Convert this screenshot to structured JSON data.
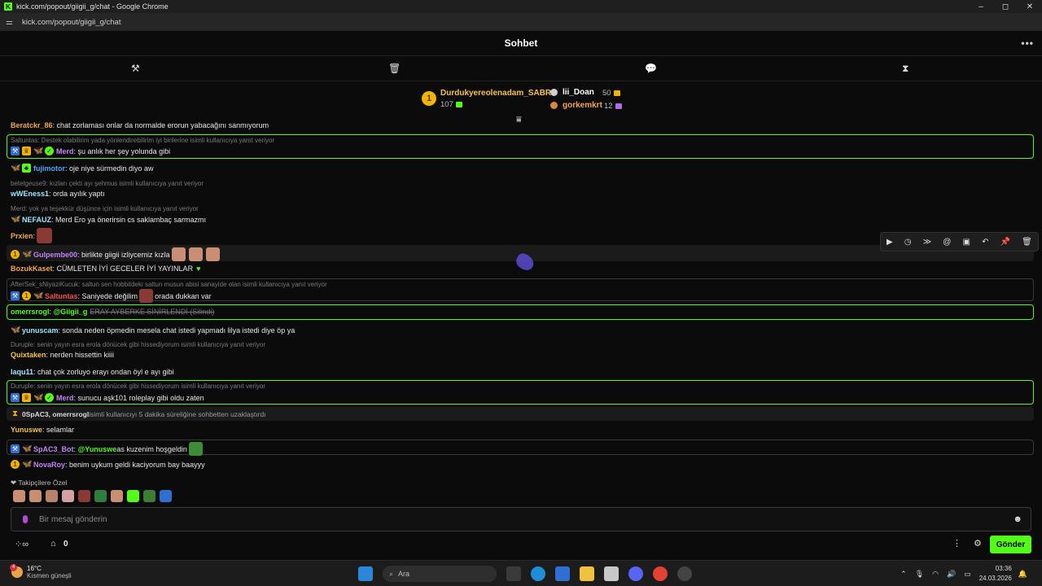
{
  "window": {
    "title": "kick.com/popout/giigii_g/chat - Google Chrome",
    "url": "kick.com/popout/giigii_g/chat",
    "controls": [
      "–",
      "◻",
      "✕"
    ]
  },
  "header": {
    "title": "Sohbet",
    "more": "•••"
  },
  "modbar": {
    "icons": [
      "hammer-icon",
      "trash-icon",
      "chat-bubble-icon",
      "hourglass-icon"
    ]
  },
  "leaderboard": {
    "first": {
      "rank": "1",
      "name": "Durdukyereolenadam_SABRI",
      "count": "107"
    },
    "second": {
      "name": "lii_Doan",
      "count": "50"
    },
    "third": {
      "name": "gorkemkrt",
      "count": "12"
    }
  },
  "messages": [
    {
      "user": "Beratckr_86",
      "text": ": chat zorlaması onlar da normalde erorun yabacağını sanmıyorum"
    },
    {
      "reply": "Saltuntas: Destek olabilirim yada yönlendirebilirim iyi birilerine isimli kullanıcıya yanıt veriyor",
      "user": "Merd",
      "text": ": şu anlık her şey yolunda gibi"
    },
    {
      "user": "fujimotor",
      "text": ": oje niye sürmedin diyo aw"
    },
    {
      "reply": "betelgeuse9: kızları çekti ayı şehmus isimli kullanıcıya yanıt veriyor",
      "user": "wWEness1",
      "text": ": orda ayılık yaptı"
    },
    {
      "reply": "Merd: yok ya teşekkür düşünce için isimli kullanıcıya yanıt veriyor",
      "user": "NEFAUZ",
      "text": ": Merd Ero ya önerirsin cs saklambaç sarmazmı"
    },
    {
      "user": "Prxien",
      "text": ":"
    },
    {
      "user": "Gulpembe00",
      "text": ": birlikte giigii izliycemiz kızla"
    },
    {
      "user": "BozukKaset",
      "text": ": CÜMLETEN İYİ GECELER İYİ YAYINLAR"
    },
    {
      "reply": "AfterSek_sNiyaziKucuk: saltun sen hobbitdeki saltun musun abisi sanayide olan isimli kullanıcıya yanıt veriyor",
      "user": "Saltuntas",
      "text": ": Saniyede değilim",
      "text2": "orada dukkan var"
    },
    {
      "user": "omerrsrogl",
      "mention": "@Giigii_g",
      "deleted": "ERAY AYBERKE SİNİRLENDİ (Silindi)"
    },
    {
      "user": "yunuscam",
      "text": ": sonda neden öpmedin mesela chat istedi yapmadı lilya istedi diye öp ya"
    },
    {
      "reply": "Duruple: senin yayın esra erola dönücek gibi hissediyorum isimli kullanıcıya yanıt veriyor",
      "user": "Quixtaken",
      "text": ": nerden hissettin kiiii"
    },
    {
      "user": "laqu11",
      "text": ": chat çok zorluyo erayı ondan öyl e ayı gibi"
    },
    {
      "reply": "Duruple: senin yayın esra erola dönücek gibi hissediyorum isimli kullanıcıya yanıt veriyor",
      "user": "Merd",
      "text": ": sunucu aşk101 roleplay gibi oldu zaten"
    },
    {
      "user": "0SpAC3, omerrsrogl",
      "text": " isimli kullanıcıyı 5 dakika süreliğine sohbetten uzaklaştırdı"
    },
    {
      "user": "Yunuswe",
      "text": ": selamlar"
    },
    {
      "user": "SpAC3_Bot",
      "mention": "@Yunuswe",
      "text": " as kuzenim hoşgeldin"
    },
    {
      "user": "NovaRoy",
      "text": ": benim uykum geldi kaciyorum bay baayyy"
    }
  ],
  "followers_label": "❤ Takipçilere Özel",
  "input": {
    "placeholder": "Bir mesaj gönderin"
  },
  "bottom": {
    "points": "0",
    "send": "Gönder"
  },
  "taskbar": {
    "temp": "16°C",
    "weather": "Kısmen güneşli",
    "weather_badge": "4",
    "search": "Ara",
    "time": "03:36",
    "date": "24.03.2026"
  },
  "colors": {
    "accent": "#53fc18",
    "bg": "#0b0b0c"
  }
}
